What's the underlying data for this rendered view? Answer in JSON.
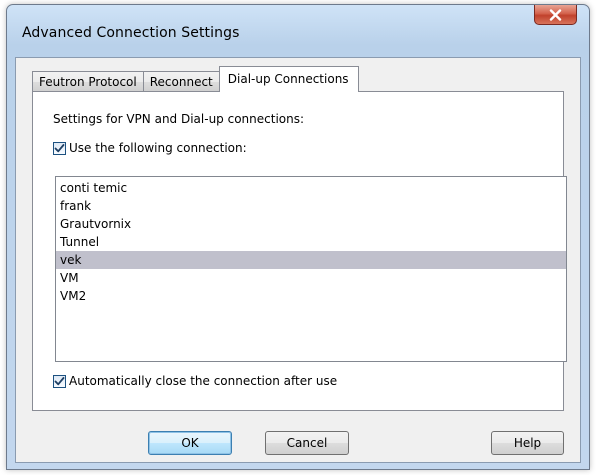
{
  "window": {
    "title": "Advanced Connection Settings"
  },
  "tabs": [
    {
      "label": "Feutron Protocol",
      "active": false
    },
    {
      "label": "Reconnect",
      "active": false
    },
    {
      "label": "Dial-up Connections",
      "active": true
    }
  ],
  "panel": {
    "heading": "Settings for VPN and Dial-up connections:",
    "use_connection": {
      "label": "Use the following connection:",
      "checked": true
    },
    "connections": [
      {
        "name": "conti temic",
        "selected": false
      },
      {
        "name": "frank",
        "selected": false
      },
      {
        "name": "Grautvornix",
        "selected": false
      },
      {
        "name": "Tunnel",
        "selected": false
      },
      {
        "name": "vek",
        "selected": true
      },
      {
        "name": "VM",
        "selected": false
      },
      {
        "name": "VM2",
        "selected": false
      }
    ],
    "auto_close": {
      "label": "Automatically close the connection after use",
      "checked": true
    }
  },
  "buttons": {
    "ok": "OK",
    "cancel": "Cancel",
    "help": "Help"
  },
  "icons": {
    "close": "close-icon",
    "check": "checkmark-icon"
  },
  "colors": {
    "selection": "#c0c0cc",
    "close_button": "#c7503a",
    "default_button_border": "#3c7fb1"
  }
}
